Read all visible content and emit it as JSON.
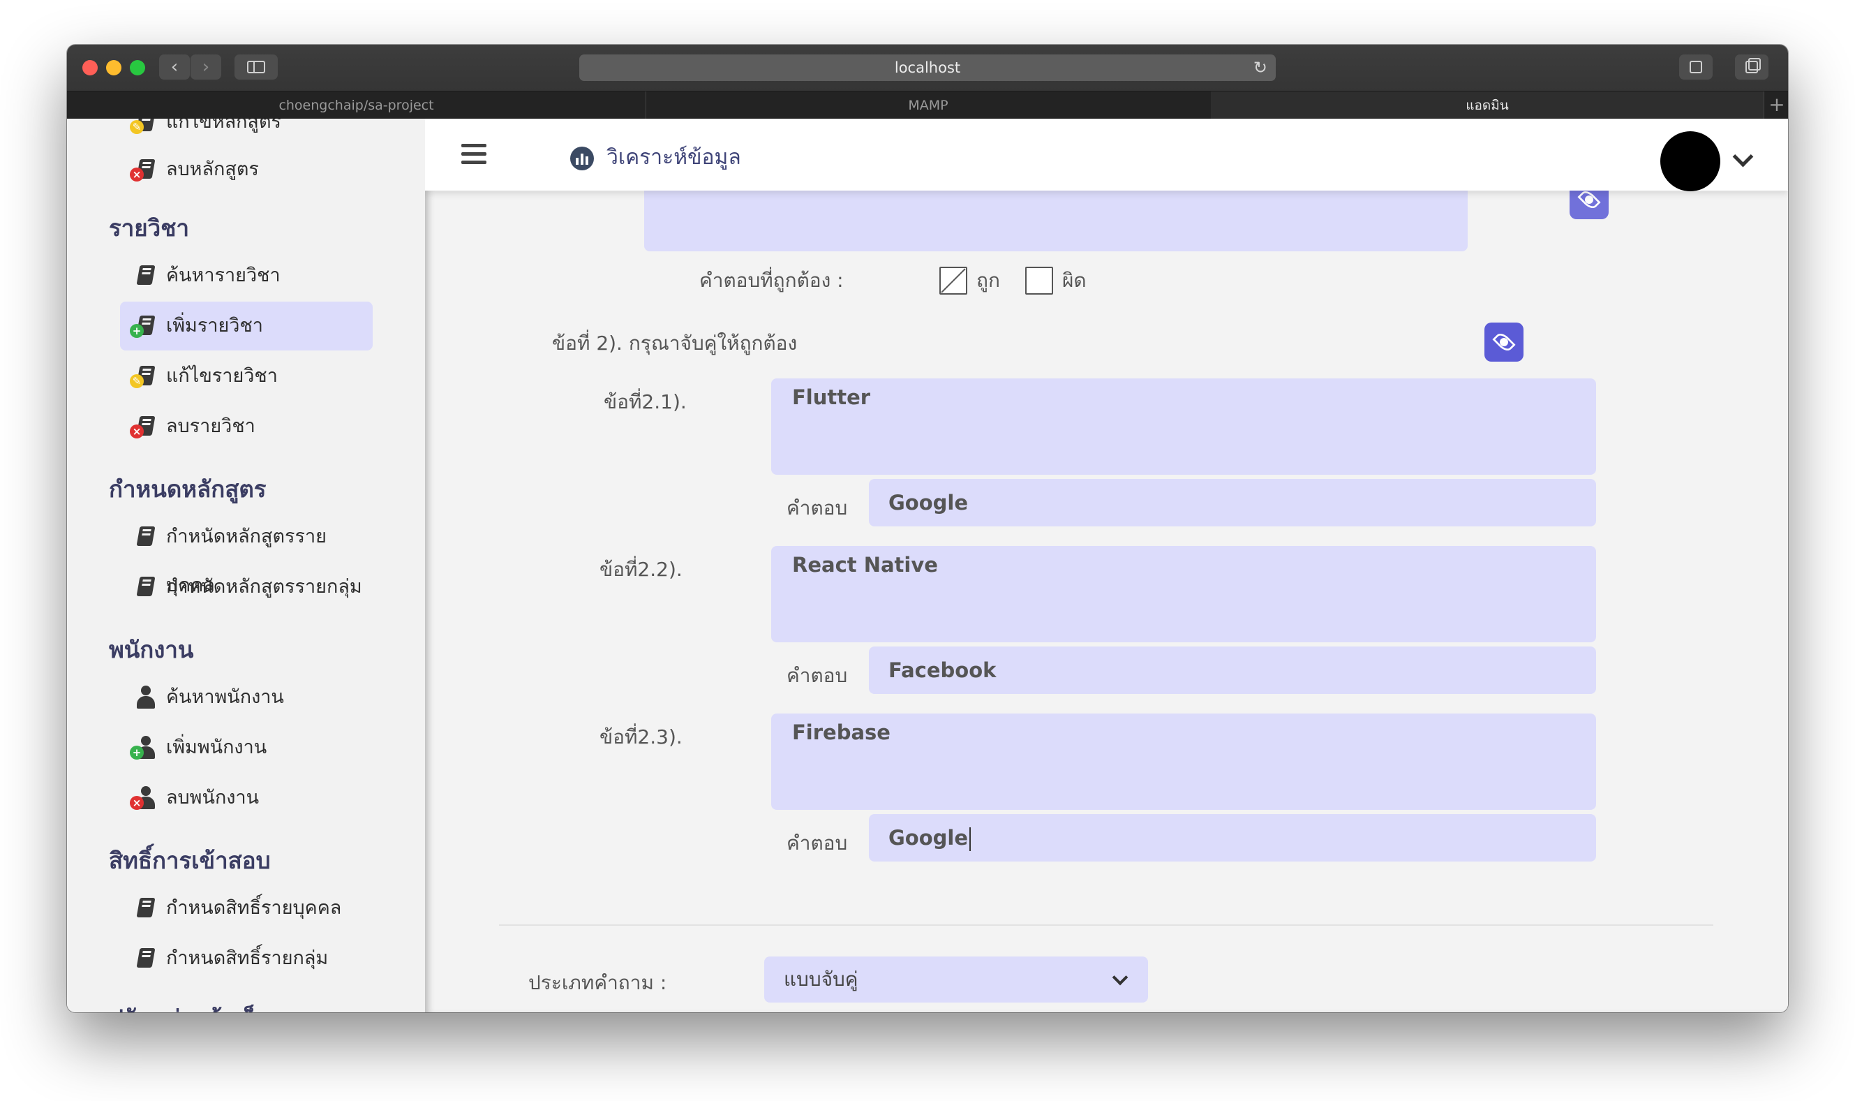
{
  "browser": {
    "url": "localhost",
    "tabs": [
      {
        "label": "choengchaip/sa-project"
      },
      {
        "label": "MAMP"
      },
      {
        "label": "แอดมิน"
      }
    ]
  },
  "header": {
    "title": "วิเคราะห์ข้อมูล"
  },
  "sidebar": {
    "items": [
      {
        "label": "แก้ไขหลักสูตร"
      },
      {
        "label": "ลบหลักสูตร"
      }
    ],
    "sections": [
      {
        "title": "รายวิชา",
        "items": [
          {
            "label": "ค้นหารายวิชา"
          },
          {
            "label": "เพิ่มรายวิชา"
          },
          {
            "label": "แก้ไขรายวิชา"
          },
          {
            "label": "ลบรายวิชา"
          }
        ]
      },
      {
        "title": "กำหนดหลักสูตร",
        "items": [
          {
            "label": "กำหนัดหลักสูตรรายบุคคล"
          },
          {
            "label": "กำหนัดหลักสูตรรายกลุ่ม"
          }
        ]
      },
      {
        "title": "พนักงาน",
        "items": [
          {
            "label": "ค้นหาพนักงาน"
          },
          {
            "label": "เพิ่มพนักงาน"
          },
          {
            "label": "ลบพนักงาน"
          }
        ]
      },
      {
        "title": "สิทธิ์การเข้าสอบ",
        "items": [
          {
            "label": "กำหนดสิทธิ์รายบุคคล"
          },
          {
            "label": "กำหนดสิทธิ์รายกลุ่ม"
          }
        ]
      },
      {
        "title": "ปรับแต่งหน้าเว็บ"
      }
    ]
  },
  "question1": {
    "correct_label": "คำตอบที่ถูกต้อง :",
    "true_label": "ถูก",
    "false_label": "ผิด"
  },
  "question2": {
    "title": "ข้อที่ 2).  กรุณาจับคู่ให้ถูกต้อง",
    "answer_label": "คำตอบ",
    "pairs": [
      {
        "label": "ข้อที่2.1).",
        "prompt": "Flutter",
        "answer": "Google"
      },
      {
        "label": "ข้อที่2.2).",
        "prompt": "React Native",
        "answer": "Facebook"
      },
      {
        "label": "ข้อที่2.3).",
        "prompt": "Firebase",
        "answer": "Google"
      }
    ]
  },
  "question_type": {
    "label": "ประเภทคำถาม :",
    "selected": "แบบจับคู่"
  },
  "colors": {
    "accent": "#5b5bd6",
    "field_bg": "#dcdcfb",
    "add": "#2f9e44",
    "remove": "#c92a2a"
  }
}
